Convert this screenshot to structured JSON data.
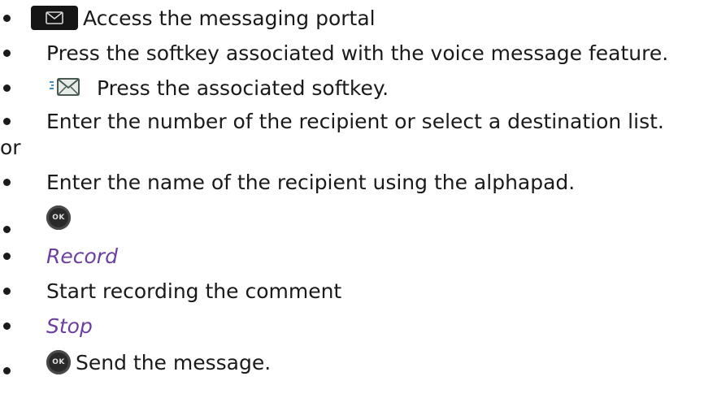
{
  "items": [
    {
      "type": "bullet",
      "icon": "envelope-key-icon",
      "text": "Access the messaging portal"
    },
    {
      "type": "bullet",
      "text": "Press the softkey associated with the voice message feature."
    },
    {
      "type": "bullet",
      "icon": "voice-mail-icon",
      "text": "Press the associated softkey."
    },
    {
      "type": "bullet",
      "text": "Enter the number of the recipient or select a destination list."
    },
    {
      "type": "plain",
      "text": "or"
    },
    {
      "type": "bullet",
      "text": "Enter the name of the recipient using the alphapad."
    },
    {
      "type": "bullet",
      "icon": "ok-key-icon",
      "icon_label": "OK",
      "text": ""
    },
    {
      "type": "bullet",
      "text": "Record",
      "style": "italic-purple"
    },
    {
      "type": "bullet",
      "text": "Start recording the comment"
    },
    {
      "type": "bullet",
      "text": "Stop",
      "style": "italic-purple"
    },
    {
      "type": "bullet",
      "icon": "ok-key-icon",
      "icon_label": "OK",
      "text": "Send the message."
    }
  ],
  "colors": {
    "text": "#1a1a1a",
    "softkey_label": "#6b3fa0",
    "key_background": "#151515"
  }
}
